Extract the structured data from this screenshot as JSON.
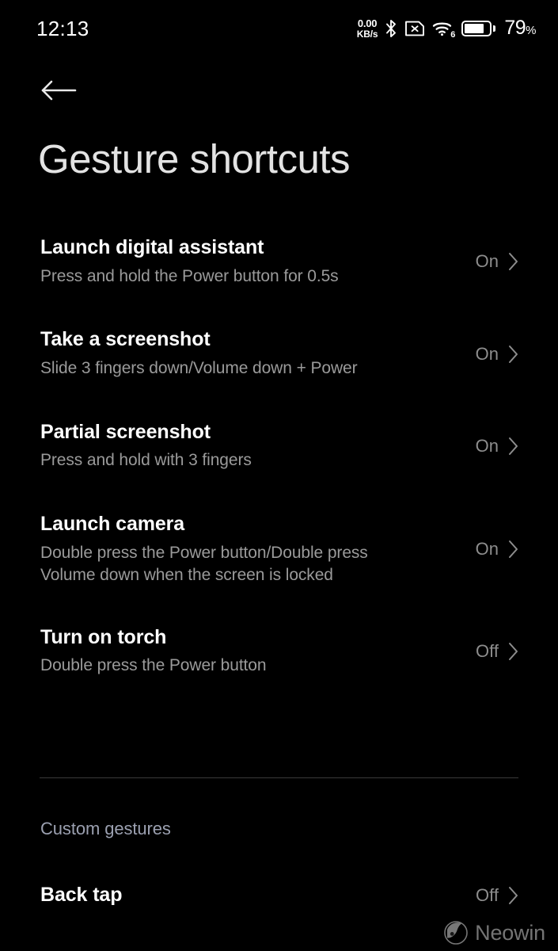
{
  "status_bar": {
    "clock": "12:13",
    "net_speed_value": "0.00",
    "net_speed_unit": "KB/s",
    "bluetooth_icon": "bluetooth-icon",
    "sim_icon": "sim-card-off-icon",
    "wifi_icon": "wifi-icon",
    "wifi_generation": "6",
    "battery_icon": "battery-icon",
    "battery_percent": "79",
    "battery_percent_sign": "%",
    "battery_level": 79
  },
  "header": {
    "back_icon": "back-arrow-icon",
    "title": "Gesture shortcuts"
  },
  "list": {
    "items": [
      {
        "title": "Launch digital assistant",
        "subtitle": "Press and hold the Power button for 0.5s",
        "value": "On",
        "chevron": "chevron-right-icon"
      },
      {
        "title": "Take a screenshot",
        "subtitle": "Slide 3 fingers down/Volume down + Power",
        "value": "On",
        "chevron": "chevron-right-icon"
      },
      {
        "title": "Partial screenshot",
        "subtitle": "Press and hold with 3 fingers",
        "value": "On",
        "chevron": "chevron-right-icon"
      },
      {
        "title": "Launch camera",
        "subtitle": "Double press the Power button/Double press\nVolume down when the screen is locked",
        "value": "On",
        "chevron": "chevron-right-icon"
      },
      {
        "title": "Turn on torch",
        "subtitle": "Double press the Power button",
        "value": "Off",
        "chevron": "chevron-right-icon"
      }
    ]
  },
  "custom_section": {
    "header": "Custom gestures",
    "items": [
      {
        "title": "Back tap",
        "value": "Off",
        "chevron": "chevron-right-icon"
      }
    ]
  },
  "watermark": {
    "label": "Neowin",
    "logo_icon": "neowin-logo-icon"
  },
  "colors": {
    "background": "#000000",
    "title": "#e3e3e3",
    "row_title": "#ffffff",
    "row_subtitle": "#9a9a9a",
    "row_value": "#8d8d8d",
    "section_header": "#9ba0b0",
    "divider": "#3a3a3a"
  }
}
